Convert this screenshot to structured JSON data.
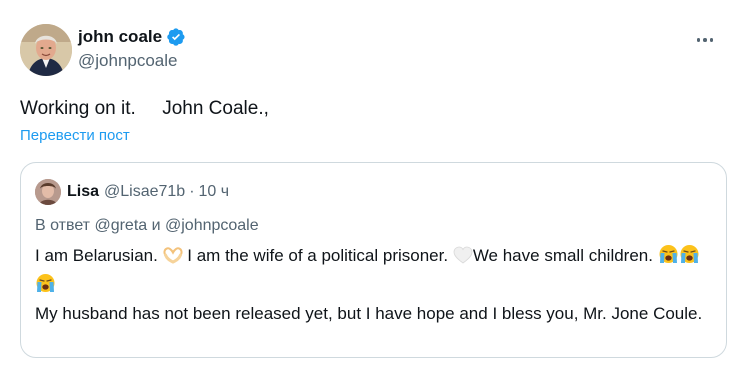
{
  "tweet": {
    "author": {
      "display_name": "john coale",
      "handle": "@johnpcoale"
    },
    "text": "Working on it.     John Coale.,",
    "translate_label": "Перевести пост",
    "more_icon": "more-horizontal-icon",
    "verified_icon": "verified-badge-icon"
  },
  "quote": {
    "author": {
      "display_name": "Lisa",
      "handle": "@Lisae71b"
    },
    "separator": "·",
    "time": "10 ч",
    "reply_to": "В ответ @greta и @johnpcoale",
    "body": {
      "part1": "I am Belarusian. ",
      "part2": " I am the wife of a political prisoner. ",
      "part3": "We have small children. ",
      "part4": "My husband has not been released yet, but I have hope and I bless you, Mr. Jone Coule."
    },
    "emojis": {
      "heart_hands": "heart-hands-emoji",
      "white_heart": "white-heart-emoji",
      "crying_faces": [
        "loudly-crying-face-emoji",
        "loudly-crying-face-emoji",
        "loudly-crying-face-emoji"
      ]
    }
  },
  "colors": {
    "accent": "#1d9bf0",
    "text": "#0f1419",
    "secondary": "#536471",
    "border": "#cfd9de"
  }
}
